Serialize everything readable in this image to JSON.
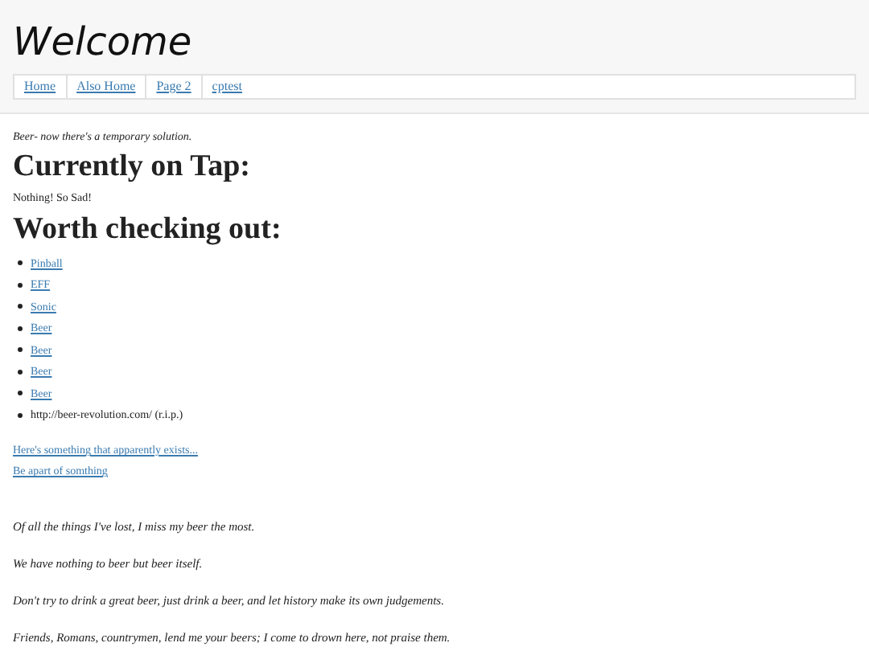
{
  "header": {
    "title": "Welcome"
  },
  "nav": [
    {
      "label": "Home"
    },
    {
      "label": "Also Home"
    },
    {
      "label": "Page 2"
    },
    {
      "label": "cptest"
    }
  ],
  "tagline": "Beer- now there's a temporary solution.",
  "on_tap": {
    "heading": "Currently on Tap:",
    "text": "Nothing! So Sad!"
  },
  "worth": {
    "heading": "Worth checking out:",
    "items": [
      {
        "kind": "link",
        "text": "Pinball"
      },
      {
        "kind": "link",
        "text": "EFF"
      },
      {
        "kind": "link",
        "text": "Sonic"
      },
      {
        "kind": "link",
        "text": "Beer"
      },
      {
        "kind": "link",
        "text": "Beer"
      },
      {
        "kind": "link",
        "text": "Beer"
      },
      {
        "kind": "link",
        "text": "Beer"
      },
      {
        "kind": "text",
        "text": "http://beer-revolution.com/ (r.i.p.)"
      }
    ]
  },
  "links": [
    "Here's something that apparently exists...",
    "Be apart of somthing"
  ],
  "quotes": [
    "Of all the things I've lost, I miss my beer the most.",
    "We have nothing to beer but beer itself.",
    "Don't try to drink a great beer, just drink a beer, and let history make its own judgements.",
    "Friends, Romans, countrymen, lend me your beers; I come to drown here, not praise them."
  ]
}
